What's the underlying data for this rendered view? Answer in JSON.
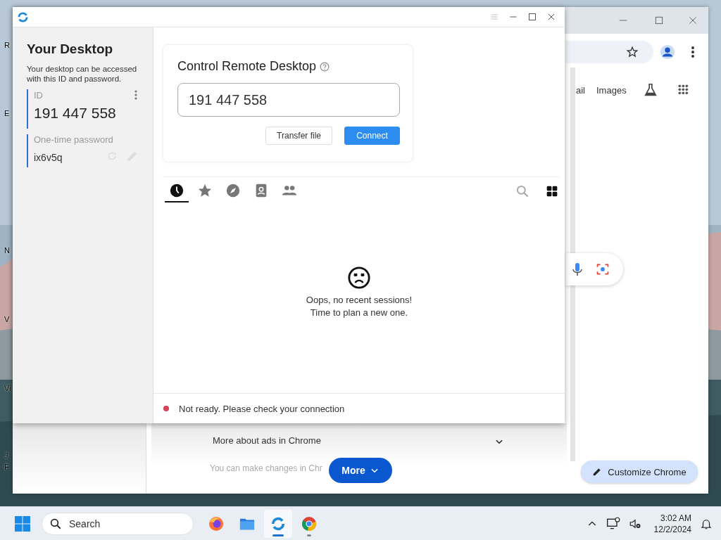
{
  "desktop": {
    "icon_labels": [
      "R",
      "E",
      "N",
      "V",
      "Vi",
      "J",
      "F"
    ]
  },
  "browser": {
    "nav_links": [
      "ail",
      "Images"
    ],
    "ads_row": "More about ads in Chrome",
    "note": "You can make changes in Chr",
    "more_button": "More",
    "customize_button": "Customize Chrome"
  },
  "app_window": {
    "sidebar": {
      "title": "Your Desktop",
      "description": "Your desktop can be accessed with this ID and password.",
      "id_label": "ID",
      "id_value": "191 447 558",
      "password_label": "One-time password",
      "password_value": "ix6v5q"
    },
    "connect_card": {
      "title": "Control Remote Desktop",
      "address_value": "191 447 558",
      "buttons": [
        {
          "label": "Transfer file",
          "kind": "secondary"
        },
        {
          "label": "Connect",
          "kind": "primary"
        }
      ]
    },
    "tabs": [
      {
        "kind": "recent",
        "selected": true
      },
      {
        "kind": "favorites",
        "selected": false
      },
      {
        "kind": "discovered",
        "selected": false
      },
      {
        "kind": "address-book",
        "selected": false
      },
      {
        "kind": "sessions",
        "selected": false
      }
    ],
    "empty_state": [
      "Oops, no recent sessions!",
      "Time to plan a new one."
    ],
    "status": "Not ready. Please check your connection"
  },
  "taskbar": {
    "search_placeholder": "Search",
    "apps": [
      {
        "kind": "firefox",
        "open": false,
        "selected": false
      },
      {
        "kind": "files",
        "open": false,
        "selected": false
      },
      {
        "kind": "remote-desktop",
        "open": true,
        "selected": true
      },
      {
        "kind": "chrome",
        "open": true,
        "selected": false
      }
    ],
    "time": "3:02 AM",
    "date": "12/2/2024"
  }
}
